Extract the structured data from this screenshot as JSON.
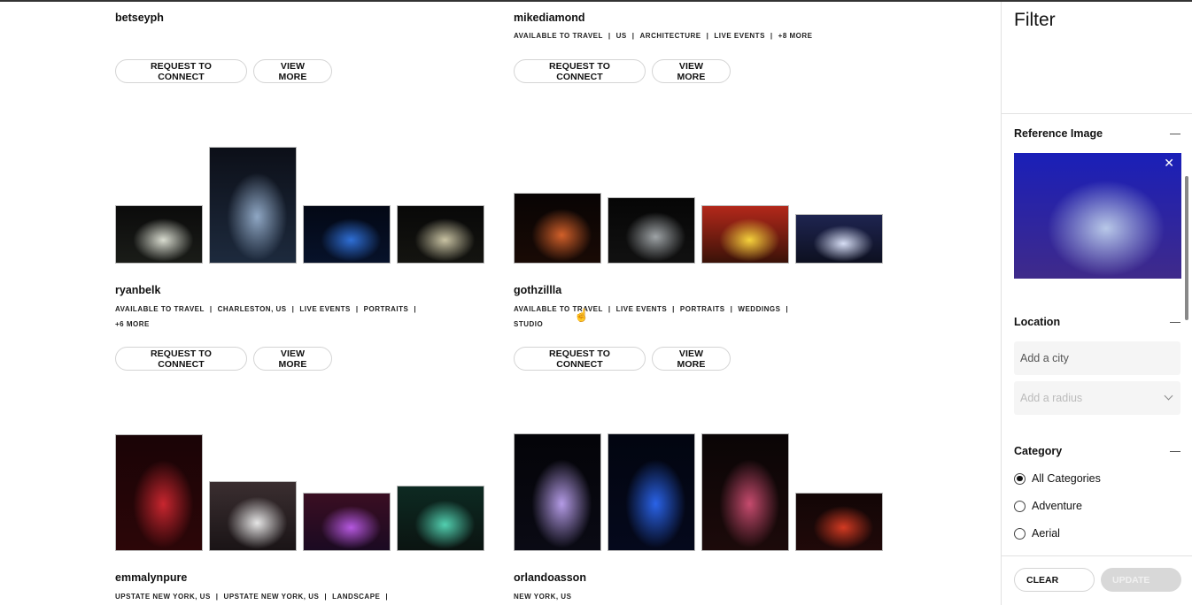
{
  "photographers": [
    {
      "username": "betseyph",
      "tags": [],
      "tags_line2": [],
      "request_label": "REQUEST TO CONNECT",
      "view_label": "VIEW MORE",
      "photos": []
    },
    {
      "username": "mikediamond",
      "tags": [
        "AVAILABLE TO TRAVEL",
        "US",
        "ARCHITECTURE",
        "LIVE EVENTS",
        "+8 MORE"
      ],
      "tags_line2": [],
      "request_label": "REQUEST TO CONNECT",
      "view_label": "VIEW MORE",
      "photos": []
    },
    {
      "username": "ryanbelk",
      "tags": [
        "AVAILABLE TO TRAVEL",
        "CHARLESTON, US",
        "LIVE EVENTS",
        "PORTRAITS"
      ],
      "tags_line2": [
        "+6 MORE"
      ],
      "request_label": "REQUEST TO CONNECT",
      "view_label": "VIEW MORE",
      "photos": [
        {
          "desc": "white light beams over crowd",
          "colors": [
            "#0b0b0b",
            "#d9dcd0",
            "#1a1c18"
          ]
        },
        {
          "desc": "performer under spotlight, tall",
          "colors": [
            "#0c0f18",
            "#8fa7c4",
            "#1d2a3d"
          ]
        },
        {
          "desc": "blue stage lights",
          "colors": [
            "#030815",
            "#2f6fd6",
            "#07122a"
          ]
        },
        {
          "desc": "single light flare",
          "colors": [
            "#080808",
            "#c9c3a3",
            "#141410"
          ]
        }
      ]
    },
    {
      "username": "gothzillla",
      "tags": [
        "AVAILABLE TO TRAVEL",
        "LIVE EVENTS",
        "PORTRAITS",
        "WEDDINGS"
      ],
      "tags_line2": [
        "STUDIO"
      ],
      "request_label": "REQUEST TO CONNECT",
      "view_label": "VIEW MORE",
      "photos": [
        {
          "desc": "orange sparks stage",
          "colors": [
            "#080404",
            "#d2602a",
            "#190a05"
          ]
        },
        {
          "desc": "crowd hands silhouette",
          "colors": [
            "#060606",
            "#9ea3a6",
            "#111111"
          ]
        },
        {
          "desc": "yellow beams red backdrop",
          "colors": [
            "#b3281a",
            "#f5d23c",
            "#3a1208"
          ]
        },
        {
          "desc": "white-blue lit stage",
          "colors": [
            "#1e2450",
            "#d7def5",
            "#0d1020"
          ]
        }
      ]
    },
    {
      "username": "emmalynpure",
      "tags": [
        "UPSTATE NEW YORK, US",
        "UPSTATE NEW YORK, US",
        "LANDSCAPE"
      ],
      "tags_line2": [],
      "request_label": "REQUEST TO CONNECT",
      "view_label": "VIEW MORE",
      "photos": [
        {
          "desc": "red haze stage, tall",
          "colors": [
            "#1a0406",
            "#c8262f",
            "#2c0608"
          ]
        },
        {
          "desc": "monochrome smoke stage",
          "colors": [
            "#3a2e30",
            "#e6e6e6",
            "#1a1416"
          ]
        },
        {
          "desc": "purple pink lights",
          "colors": [
            "#3a0e22",
            "#b558e0",
            "#1b0a22"
          ]
        },
        {
          "desc": "teal green lights",
          "colors": [
            "#0d2a22",
            "#52d0b0",
            "#0b1411"
          ]
        }
      ]
    },
    {
      "username": "orlandoasson",
      "tags": [
        "NEW YORK, US"
      ],
      "tags_line2": [],
      "request_label": "REQUEST TO CONNECT",
      "view_label": "VIEW MORE",
      "photos": [
        {
          "desc": "purple lit performer, tall",
          "colors": [
            "#040408",
            "#b49be6",
            "#0a0a14"
          ]
        },
        {
          "desc": "blue spotlight fan, tall",
          "colors": [
            "#020510",
            "#2a63e8",
            "#05091c"
          ]
        },
        {
          "desc": "pink lit singer over crowd, tall",
          "colors": [
            "#0a0506",
            "#c64b6e",
            "#1c0a0a"
          ]
        },
        {
          "desc": "red haze band",
          "colors": [
            "#120606",
            "#d33a22",
            "#200909"
          ]
        }
      ]
    }
  ],
  "sidebar": {
    "title": "Filter",
    "reference_image": {
      "title": "Reference Image",
      "desc": "performer in green shirt on stage, blue-lit crowd",
      "colors": [
        "#1a1fb8",
        "#b8c8e8",
        "#3f2a8a"
      ]
    },
    "location": {
      "title": "Location",
      "city_placeholder": "Add a city",
      "radius_placeholder": "Add a radius"
    },
    "category": {
      "title": "Category",
      "options": [
        {
          "label": "All Categories",
          "checked": true
        },
        {
          "label": "Adventure",
          "checked": false
        },
        {
          "label": "Aerial",
          "checked": false
        }
      ]
    },
    "clear_label": "CLEAR",
    "update_label": "UPDATE"
  },
  "icons": {
    "collapse": "minus-icon",
    "close": "close-icon",
    "chevron": "chevron-down-icon",
    "cursor": "hand-pointer-icon"
  }
}
